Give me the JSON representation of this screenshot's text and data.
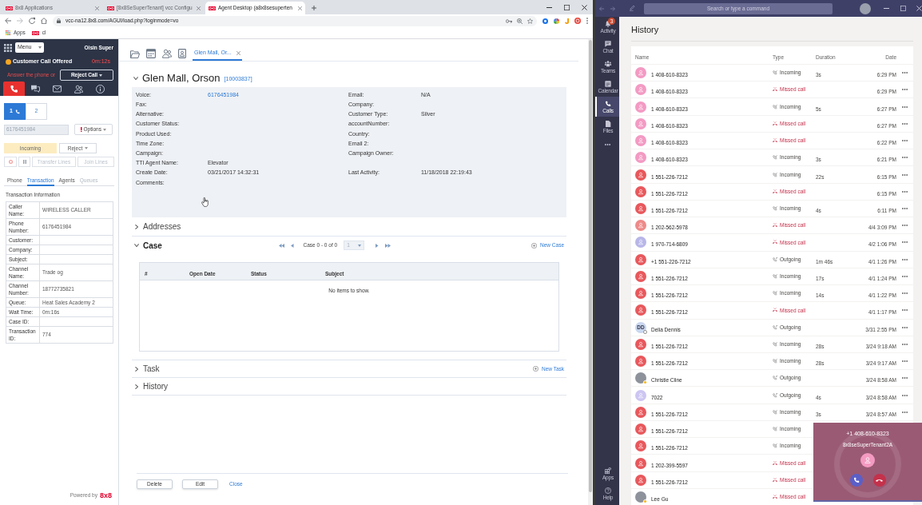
{
  "browser": {
    "tabs": [
      {
        "title": "8x8 Applications",
        "selected": false
      },
      {
        "title": "[8x8SeSuperTenant] vcc Configu",
        "selected": false
      },
      {
        "title": "Agent Desktop (a8x8sesuperten",
        "selected": true
      }
    ],
    "url": "vcc-na12.8x8.com/AGUI/load.php?loginmode=vo",
    "bookmarks": [
      {
        "label": "Apps",
        "kind": "apps"
      },
      {
        "label": "cl",
        "kind": "site"
      }
    ]
  },
  "agent_panel": {
    "menu": "Menu",
    "agent_name": "Oisin Super",
    "status": "Customer Call Offered",
    "timer": "0m:12s",
    "prompt": "Answer the phone or",
    "reject_call": "Reject Call",
    "media_tabs": [
      {
        "kind": "phone",
        "selected": true
      },
      {
        "kind": "chat",
        "selected": false
      },
      {
        "kind": "email",
        "selected": false
      },
      {
        "kind": "people",
        "selected": false
      },
      {
        "kind": "info",
        "selected": false
      }
    ],
    "lines": [
      {
        "label": "1",
        "selected": true
      },
      {
        "label": "2",
        "selected": false
      }
    ],
    "phone_number": "6176451984",
    "options": "Options",
    "call_state": "Incoming",
    "reject": "Reject",
    "call_controls": [
      {
        "kind": "record",
        "disabled": true
      },
      {
        "kind": "pause",
        "disabled": true
      },
      {
        "kind": "text",
        "label": "Transfer Lines",
        "disabled": true
      },
      {
        "kind": "text",
        "label": "Join Lines",
        "disabled": true
      }
    ],
    "tabs": [
      {
        "label": "Phone",
        "selected": false,
        "disabled": false
      },
      {
        "label": "Transaction",
        "selected": true,
        "disabled": false
      },
      {
        "label": "Agents",
        "selected": false,
        "disabled": false
      },
      {
        "label": "Queues",
        "selected": false,
        "disabled": true
      }
    ],
    "section_title": "Transaction Information",
    "transaction": [
      {
        "key": "Caller Name:",
        "value": "WIRELESS CALLER"
      },
      {
        "key": "Phone Number:",
        "value": "6176451984"
      },
      {
        "key": "Customer:"
      },
      {
        "key": "Company:"
      },
      {
        "key": "Subject:"
      },
      {
        "key": "Channel Name:",
        "value": "Trade og"
      },
      {
        "key": "Channel Number:",
        "value": "18772735821"
      },
      {
        "key": "Queue:",
        "value": "Heat Sales Academy 2"
      },
      {
        "key": "Wait Time:",
        "value": "0m:16s"
      },
      {
        "key": "Case ID:"
      },
      {
        "key": "Transaction ID:",
        "value": "774"
      }
    ],
    "powered_by": "Powered by",
    "brand": "8x8"
  },
  "workspace": {
    "toolbar": [
      {
        "kind": "folder"
      },
      {
        "kind": "calendar"
      },
      {
        "kind": "people"
      },
      {
        "kind": "contact"
      }
    ],
    "tabs": [
      {
        "label": "Glen Mall, Or...",
        "selected": true
      }
    ],
    "record": {
      "title": "Glen Mall, Orson",
      "id": "[10003837]",
      "expanded": true,
      "rows": [
        {
          "left": {
            "label": "Voice:",
            "value": "6176451984",
            "link": true
          },
          "right": {
            "label": "Email:",
            "value": "N/A"
          }
        },
        {
          "left": {
            "label": "Fax:"
          },
          "right": {
            "label": "Company:"
          }
        },
        {
          "left": {
            "label": "Alternative:"
          },
          "right": {
            "label": "Customer Type:",
            "value": "Silver"
          }
        },
        {
          "left": {
            "label": "Customer Status:"
          },
          "right": {
            "label": "accountNumber:"
          }
        },
        {
          "left": {
            "label": "Product Used:"
          },
          "right": {
            "label": "Country:"
          }
        },
        {
          "left": {
            "label": "Time Zone:"
          },
          "right": {
            "label": "Email 2:"
          }
        },
        {
          "left": {
            "label": "Campaign:"
          },
          "right": {
            "label": "Campaign Owner:"
          }
        },
        {
          "left": {
            "label": "TTI Agent Name:",
            "value": "Elevator"
          }
        },
        {
          "left": {
            "label": "Create Date:",
            "value": "03/21/2017 14:32:31"
          },
          "right": {
            "label": "Last Activity:",
            "value": "11/18/2018 22:19:43"
          }
        },
        {
          "left": {
            "label": "Comments:"
          }
        }
      ]
    },
    "sections": [
      {
        "kind": "plain",
        "title": "Addresses",
        "expanded": false
      },
      {
        "kind": "case",
        "title": "Case",
        "expanded": true,
        "pager": {
          "label": "Case 0 - 0 of 0",
          "page": "1"
        },
        "action": "New Case",
        "table": {
          "columns": [
            "#",
            "Open Date",
            "Status",
            "Subject"
          ],
          "empty": "No items to show."
        }
      },
      {
        "kind": "plain",
        "title": "Task",
        "expanded": false,
        "action": "New Task"
      },
      {
        "kind": "plain",
        "title": "History",
        "expanded": false
      }
    ],
    "buttons": [
      {
        "label": "Delete",
        "kind": "button"
      },
      {
        "label": "Edit",
        "kind": "button"
      },
      {
        "label": "Close",
        "kind": "link"
      }
    ]
  },
  "teams": {
    "search": {
      "placeholder": "Search or type a command"
    },
    "rail": [
      {
        "label": "Activity",
        "kind": "activity",
        "selected": false,
        "badge": "3"
      },
      {
        "label": "Chat",
        "kind": "chat",
        "selected": false
      },
      {
        "label": "Teams",
        "kind": "teams",
        "selected": false
      },
      {
        "label": "Calendar",
        "kind": "calendar",
        "selected": false
      },
      {
        "label": "Calls",
        "kind": "calls",
        "selected": true
      },
      {
        "label": "Files",
        "kind": "files",
        "selected": false
      }
    ],
    "rail_bottom": [
      {
        "label": "Apps",
        "kind": "apps"
      },
      {
        "label": "Help",
        "kind": "help"
      }
    ],
    "title": "History",
    "columns": [
      "Name",
      "Type",
      "Duration",
      "Date"
    ],
    "calls": [
      {
        "name": "1 408-610-8323",
        "avatar": {
          "kind": "icon",
          "color": "#f39ac3"
        },
        "type": "Incoming",
        "kind": "incoming",
        "duration": "3s",
        "date": "6:29 PM"
      },
      {
        "name": "1 408-610-8323",
        "avatar": {
          "kind": "icon",
          "color": "#f39ac3"
        },
        "type": "Missed call",
        "kind": "missed",
        "date": "6:29 PM"
      },
      {
        "name": "1 408-610-8323",
        "avatar": {
          "kind": "icon",
          "color": "#f39ac3"
        },
        "type": "Incoming",
        "kind": "incoming",
        "duration": "5s",
        "date": "6:27 PM"
      },
      {
        "name": "1 408-610-8323",
        "avatar": {
          "kind": "icon",
          "color": "#f39ac3"
        },
        "type": "Missed call",
        "kind": "missed",
        "date": "6:27 PM"
      },
      {
        "name": "1 408-610-8323",
        "avatar": {
          "kind": "icon",
          "color": "#f39ac3"
        },
        "type": "Missed call",
        "kind": "missed",
        "date": "6:22 PM"
      },
      {
        "name": "1 408-610-8323",
        "avatar": {
          "kind": "icon",
          "color": "#f39ac3"
        },
        "type": "Incoming",
        "kind": "incoming",
        "duration": "3s",
        "date": "6:21 PM"
      },
      {
        "name": "1 551-226-7212",
        "avatar": {
          "kind": "icon",
          "color": "#e8585c"
        },
        "type": "Incoming",
        "kind": "incoming",
        "duration": "22s",
        "date": "6:15 PM"
      },
      {
        "name": "1 551-226-7212",
        "avatar": {
          "kind": "icon",
          "color": "#e8585c"
        },
        "type": "Missed call",
        "kind": "missed",
        "date": "6:15 PM"
      },
      {
        "name": "1 551-226-7212",
        "avatar": {
          "kind": "icon",
          "color": "#e8585c"
        },
        "type": "Incoming",
        "kind": "incoming",
        "duration": "4s",
        "date": "6:11 PM"
      },
      {
        "name": "1 202-562-5978",
        "avatar": {
          "kind": "icon",
          "color": "#ee8a8a"
        },
        "type": "Missed call",
        "kind": "missed",
        "date": "4/4 3:09 PM"
      },
      {
        "name": "1 970-714-6809",
        "avatar": {
          "kind": "icon",
          "color": "#b8b6e8"
        },
        "type": "Missed call",
        "kind": "missed",
        "date": "4/2 1:06 PM"
      },
      {
        "name": "+1 551-226-7212",
        "avatar": {
          "kind": "icon",
          "color": "#e8585c"
        },
        "type": "Outgoing",
        "kind": "outgoing",
        "duration": "1m 46s",
        "date": "4/1 1:26 PM"
      },
      {
        "name": "1 551-226-7212",
        "avatar": {
          "kind": "icon",
          "color": "#e8585c"
        },
        "type": "Incoming",
        "kind": "incoming",
        "duration": "17s",
        "date": "4/1 1:24 PM"
      },
      {
        "name": "1 551-226-7212",
        "avatar": {
          "kind": "icon",
          "color": "#e8585c"
        },
        "type": "Incoming",
        "kind": "incoming",
        "duration": "14s",
        "date": "4/1 1:22 PM"
      },
      {
        "name": "1 551-226-7212",
        "avatar": {
          "kind": "icon",
          "color": "#e8585c"
        },
        "type": "Missed call",
        "kind": "missed",
        "date": "4/1 1:17 PM"
      },
      {
        "name": "Delia Dennis",
        "avatar": {
          "kind": "initials",
          "initials": "DD",
          "color": "#c9d6ee",
          "presence": {
            "kind": "offline"
          }
        },
        "type": "Outgoing",
        "kind": "outgoing",
        "date": "3/31 2:55 PM"
      },
      {
        "name": "1 551-226-7212",
        "avatar": {
          "kind": "icon",
          "color": "#e8585c"
        },
        "type": "Incoming",
        "kind": "incoming",
        "duration": "28s",
        "date": "3/24 9:18 AM"
      },
      {
        "name": "1 551-226-7212",
        "avatar": {
          "kind": "icon",
          "color": "#e8585c"
        },
        "type": "Incoming",
        "kind": "incoming",
        "duration": "28s",
        "date": "3/24 9:17 AM"
      },
      {
        "name": "Christie Cline",
        "avatar": {
          "kind": "photo",
          "presence": {
            "kind": "away"
          }
        },
        "type": "Outgoing",
        "kind": "outgoing",
        "date": "3/24 8:58 AM"
      },
      {
        "name": "7022",
        "avatar": {
          "kind": "icon",
          "color": "#cdc6f2"
        },
        "type": "Outgoing",
        "kind": "outgoing",
        "duration": "4s",
        "date": "3/24 8:58 AM"
      },
      {
        "name": "1 551-226-7212",
        "avatar": {
          "kind": "icon",
          "color": "#e8585c"
        },
        "type": "Incoming",
        "kind": "incoming",
        "duration": "3s",
        "date": "3/24 8:57 AM"
      },
      {
        "name": "1 551-226-7212",
        "avatar": {
          "kind": "icon",
          "color": "#e8585c"
        },
        "type": "Incoming",
        "kind": "incoming"
      },
      {
        "name": "1 551-226-7212",
        "avatar": {
          "kind": "icon",
          "color": "#e8585c"
        },
        "type": "Incoming",
        "kind": "incoming"
      },
      {
        "name": "1 202-399-5597",
        "avatar": {
          "kind": "icon",
          "color": "#e8585c"
        },
        "type": "Missed call",
        "kind": "missed"
      },
      {
        "name": "1 551-226-7212",
        "avatar": {
          "kind": "icon",
          "color": "#e8585c"
        },
        "type": "Missed call",
        "kind": "missed"
      },
      {
        "name": "Lee Gu",
        "avatar": {
          "kind": "photo",
          "presence": {
            "kind": "away"
          }
        },
        "type": "Missed call",
        "kind": "missed"
      }
    ],
    "incoming_call": {
      "number": "+1 408-610-8323",
      "caller": "8x8seSuperTenant2A"
    }
  }
}
